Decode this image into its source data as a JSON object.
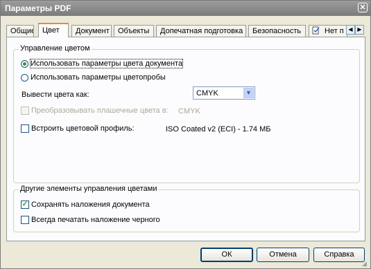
{
  "window": {
    "title": "Параметры PDF",
    "close_glyph": "✕"
  },
  "tabs": [
    {
      "label": "Общие"
    },
    {
      "label": "Цвет"
    },
    {
      "label": "Документ"
    },
    {
      "label": "Объекты"
    },
    {
      "label": "Допечатная подготовка"
    },
    {
      "label": "Безопасность"
    },
    {
      "label": "Нет п"
    }
  ],
  "tab_scroll": {
    "left_glyph": "◀",
    "right_glyph": "▶"
  },
  "color_management": {
    "group_label": "Управление цветом",
    "radio_document": "Использовать параметры цвета документа",
    "radio_proof": "Использовать параметры цветопробы",
    "output_label": "Вывести цвета как:",
    "output_value": "CMYK",
    "convert_spot_label": "Преобразовывать плашечные цвета в:",
    "convert_spot_value": "CMYK",
    "embed_profile_label": "Встроить цветовой профиль:",
    "embed_profile_value": "ISO Coated v2 (ECI) - 1.74 МБ"
  },
  "other_management": {
    "group_label": "Другие элементы управления цветами",
    "keep_overprint": "Сохранять наложения документа",
    "always_black_overprint": "Всегда печатать наложение черного"
  },
  "buttons": {
    "ok": "ОК",
    "cancel": "Отмена",
    "help": "Справка"
  },
  "colors": {
    "accent_tab": "#e68b2c",
    "check_mark": "#21a121",
    "dialog_bg": "#ece9d8"
  }
}
